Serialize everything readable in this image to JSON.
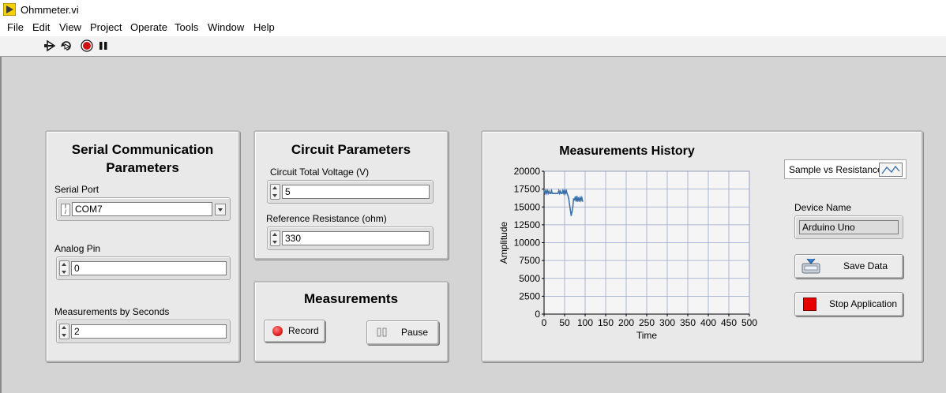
{
  "window": {
    "title": "Ohmmeter.vi"
  },
  "menu": [
    "File",
    "Edit",
    "View",
    "Project",
    "Operate",
    "Tools",
    "Window",
    "Help"
  ],
  "toolbar": {
    "icons": [
      "run-arrow-icon",
      "run-continuously-icon",
      "abort-stop-icon",
      "pause-icon"
    ]
  },
  "serial_panel": {
    "title_line1": "Serial Communication",
    "title_line2": "Parameters",
    "serial_port_label": "Serial Port",
    "serial_port_value": "COM7",
    "analog_pin_label": "Analog Pin",
    "analog_pin_value": "0",
    "measurements_label": "Measurements by Seconds",
    "measurements_value": "2"
  },
  "circuit_panel": {
    "title": "Circuit Parameters",
    "voltage_label": "Circuit Total Voltage (V)",
    "voltage_value": "5",
    "resistance_label": "Reference Resistance (ohm)",
    "resistance_value": "330"
  },
  "measurements_panel": {
    "title": "Measurements",
    "record_label": "Record",
    "pause_label": "Pause"
  },
  "history_panel": {
    "title": "Measurements History",
    "legend_label": "Sample vs Resistance",
    "device_name_label": "Device Name",
    "device_name_value": "Arduino Uno",
    "save_label": "Save Data",
    "stop_label": "Stop Application"
  },
  "colors": {
    "plot_line": "#3a6ea8",
    "grid": "#9aa6cc",
    "record_led": "#e02020",
    "stop_square": "#e60000"
  },
  "chart_data": {
    "type": "line",
    "title": "Measurements History",
    "xlabel": "Time",
    "ylabel": "Amplitude",
    "xlim": [
      0,
      500
    ],
    "ylim": [
      0,
      20000
    ],
    "x_ticks": [
      0,
      50,
      100,
      150,
      200,
      250,
      300,
      350,
      400,
      450,
      500
    ],
    "y_ticks": [
      0,
      2500,
      5000,
      7500,
      10000,
      12500,
      15000,
      17500,
      20000
    ],
    "y_tick_labels": [
      "0",
      "2500",
      "5000",
      "7500",
      "10000",
      "12500",
      "15000",
      "17500",
      "20000"
    ],
    "grid": true,
    "series": [
      {
        "name": "Sample vs Resistance",
        "x": [
          0,
          2,
          4,
          6,
          8,
          10,
          12,
          14,
          16,
          18,
          20,
          22,
          24,
          26,
          28,
          30,
          32,
          34,
          36,
          38,
          40,
          42,
          44,
          46,
          48,
          50,
          52,
          54,
          56,
          58,
          60,
          62,
          64,
          66,
          68,
          70,
          72,
          74,
          76,
          78,
          80,
          82,
          84,
          86,
          88,
          90,
          92,
          94
        ],
        "y": [
          17200,
          16900,
          17300,
          16900,
          17300,
          16900,
          17200,
          16900,
          16900,
          17300,
          16900,
          16900,
          16900,
          16900,
          16900,
          16900,
          16900,
          16900,
          17300,
          16900,
          17200,
          16900,
          16900,
          17300,
          16900,
          17300,
          16900,
          17300,
          16900,
          16600,
          16200,
          15400,
          14600,
          13800,
          14300,
          15000,
          16100,
          16000,
          16400,
          15800,
          16500,
          15800,
          16300,
          15800,
          16300,
          15900,
          16300,
          15800
        ]
      }
    ]
  }
}
